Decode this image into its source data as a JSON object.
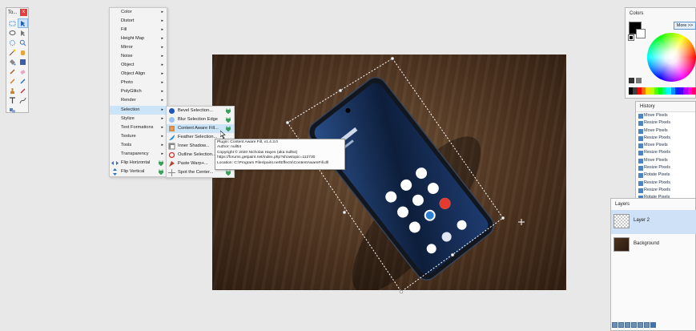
{
  "tools_window": {
    "title": "To...",
    "close_label": "x"
  },
  "main_menu": {
    "items": [
      {
        "label": "Color",
        "arrow": "▸"
      },
      {
        "label": "Distort",
        "arrow": "▸"
      },
      {
        "label": "Fill",
        "arrow": "▸"
      },
      {
        "label": "Height Map",
        "arrow": "▸"
      },
      {
        "label": "Mirror",
        "arrow": "▸"
      },
      {
        "label": "Noise",
        "arrow": "▸"
      },
      {
        "label": "Object",
        "arrow": "▸"
      },
      {
        "label": "Object Align",
        "arrow": "▸"
      },
      {
        "label": "Photo",
        "arrow": "▸"
      },
      {
        "label": "PolyGlitch",
        "arrow": "▸"
      },
      {
        "label": "Render",
        "arrow": "▸"
      },
      {
        "label": "Selection",
        "arrow": "▸"
      },
      {
        "label": "Stylize",
        "arrow": "▸"
      },
      {
        "label": "Text Formations",
        "arrow": "▸"
      },
      {
        "label": "Texture",
        "arrow": "▸"
      },
      {
        "label": "Tools",
        "arrow": "▸"
      },
      {
        "label": "Transparency",
        "arrow": "▸"
      },
      {
        "label": "Flip Horizontal",
        "arrow": ""
      },
      {
        "label": "Flip Vertical",
        "arrow": ""
      }
    ]
  },
  "selection_submenu": {
    "items": [
      {
        "label": "Bevel Selection..."
      },
      {
        "label": "Blur Selection Edge"
      },
      {
        "label": "Content Aware Fill..."
      },
      {
        "label": "Feather Selection..."
      },
      {
        "label": "Inner Shadow..."
      },
      {
        "label": "Outline Selection..."
      },
      {
        "label": "Paste Warp+..."
      },
      {
        "label": "Spot the Center..."
      }
    ]
  },
  "tooltip": {
    "line1": "Plugin: Content Aware Fill, v1.4.3.0",
    "line2": "Author: null54",
    "line3": "Copyright © 2020 Nicholas Hayes (aka null54)",
    "line4": "https://forums.getpaint.net/index.php?showtopic=112730",
    "line5": "Location: C:\\Program Files\\paint.net\\Effects\\ContentAwareFill.dll"
  },
  "colors_panel": {
    "title": "Colors",
    "more_label": "More >>",
    "primary": "#000000",
    "secondary": "#ffffff"
  },
  "history_panel": {
    "title": "History",
    "items": [
      "Move Pixels",
      "Resize Pixels",
      "Move Pixels",
      "Resize Pixels",
      "Move Pixels",
      "Resize Pixels",
      "Move Pixels",
      "Resize Pixels",
      "Rotate Pixels",
      "Resize Pixels",
      "Resize Pixels",
      "Rotate Pixels"
    ]
  },
  "layers_panel": {
    "title": "Layers",
    "layers": [
      {
        "name": "Layer 2"
      },
      {
        "name": "Background"
      }
    ]
  },
  "colors": {
    "menu_highlight": "#cce4f7",
    "layer_selected": "#cfe1f6",
    "plugin_green": "#3aa05a"
  }
}
